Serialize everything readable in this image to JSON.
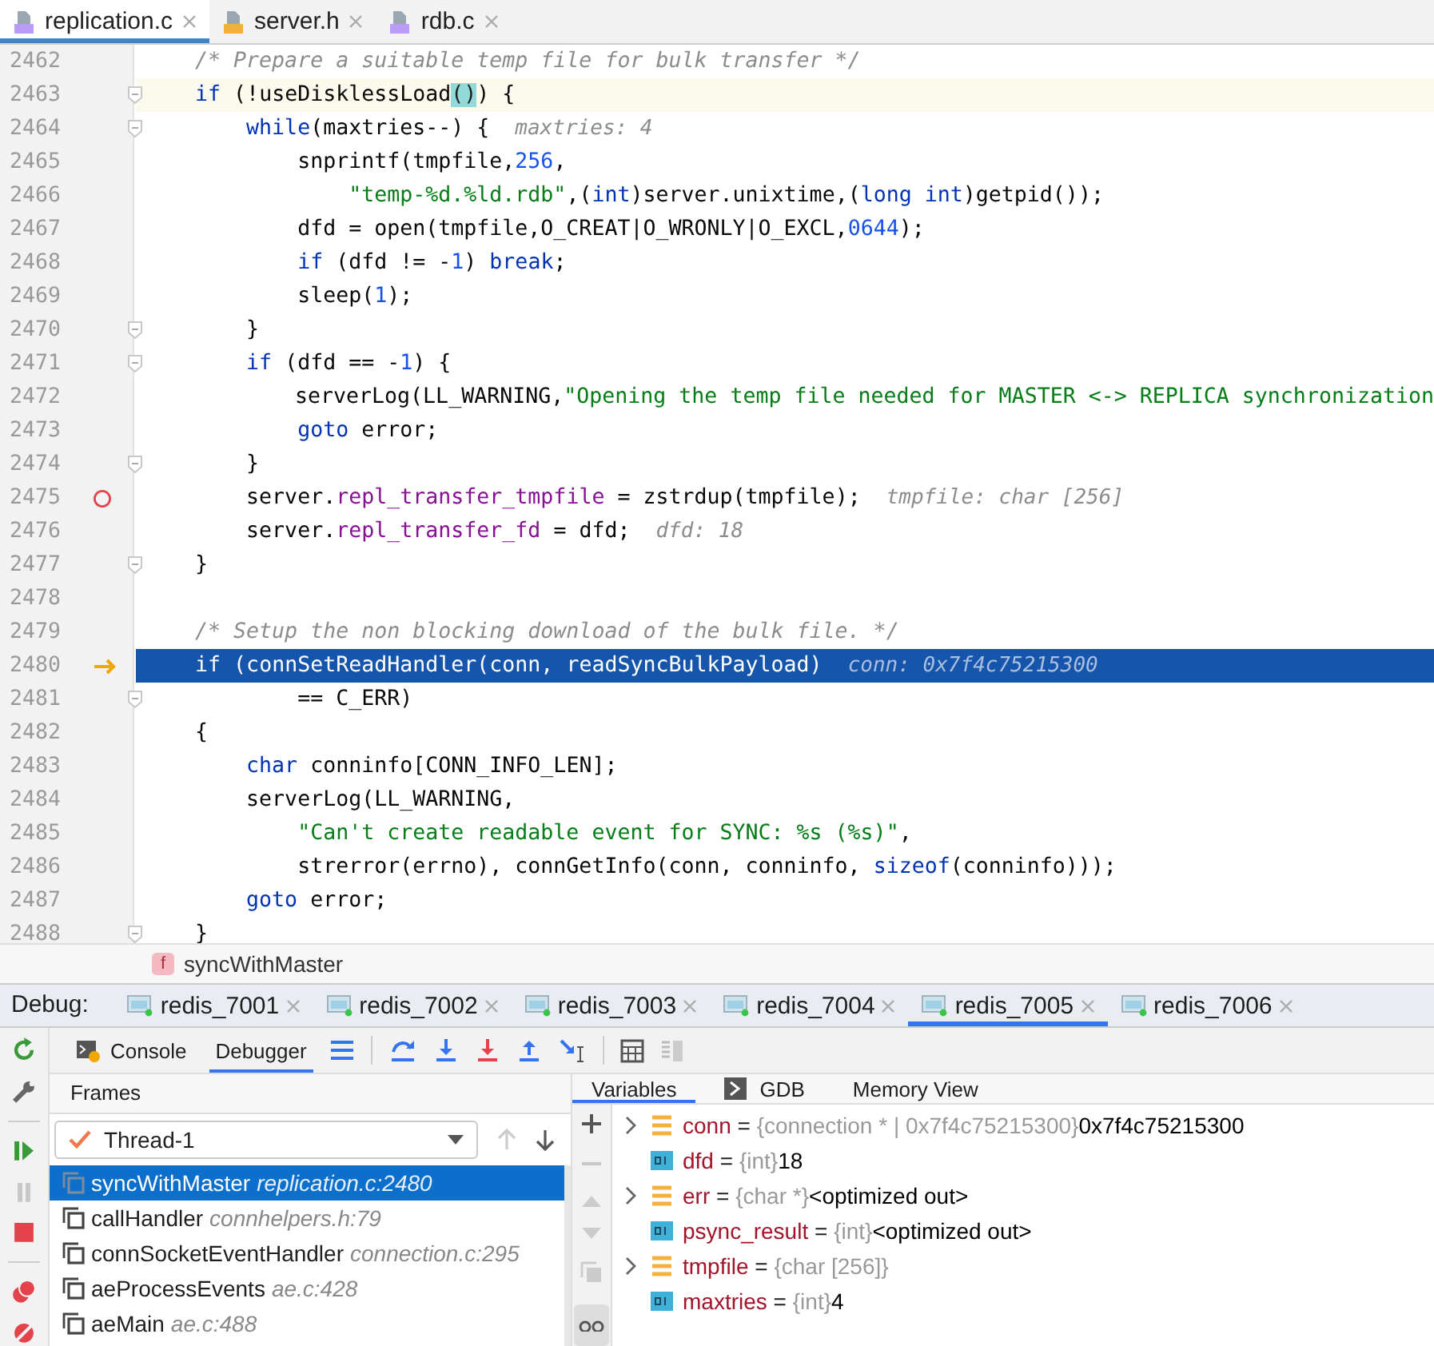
{
  "editor_tabs": [
    {
      "name": "replication.c",
      "kind": "c-source",
      "selected": true
    },
    {
      "name": "server.h",
      "kind": "header",
      "selected": false
    },
    {
      "name": "rdb.c",
      "kind": "c-source",
      "selected": false
    }
  ],
  "lines": [
    {
      "number": "2462",
      "tokens": [
        {
          "text": "    /* Prepare a suitable temp file for bulk transfer */",
          "kind": "comment"
        }
      ]
    },
    {
      "number": "2463",
      "kind": "caret-line",
      "foldable": true,
      "tokens": [
        {
          "text": "    if",
          "kind": "keyword"
        },
        {
          "text": " (!useDisklessLoad",
          "kind": "plain"
        },
        {
          "text": "()",
          "kind": "match"
        },
        {
          "text": ") {",
          "kind": "plain"
        }
      ]
    },
    {
      "number": "2464",
      "foldable": true,
      "tokens": [
        {
          "text": "        while",
          "kind": "keyword"
        },
        {
          "text": "(maxtries--) {",
          "kind": "plain"
        }
      ],
      "hint": "maxtries: 4"
    },
    {
      "number": "2465",
      "tokens": [
        {
          "text": "            snprintf(tmpfile,",
          "kind": "plain"
        },
        {
          "text": "256",
          "kind": "number"
        },
        {
          "text": ",",
          "kind": "plain"
        }
      ]
    },
    {
      "number": "2466",
      "tokens": [
        {
          "text": "                \"temp-%d.%ld.rdb\"",
          "kind": "string"
        },
        {
          "text": ",(",
          "kind": "plain"
        },
        {
          "text": "int",
          "kind": "keyword"
        },
        {
          "text": ")server.unixtime,(",
          "kind": "plain"
        },
        {
          "text": "long int",
          "kind": "keyword"
        },
        {
          "text": ")getpid());",
          "kind": "plain"
        }
      ]
    },
    {
      "number": "2467",
      "tokens": [
        {
          "text": "            dfd = open(tmpfile,O_CREAT|O_WRONLY|O_EXCL,",
          "kind": "plain"
        },
        {
          "text": "0644",
          "kind": "number"
        },
        {
          "text": ");",
          "kind": "plain"
        }
      ]
    },
    {
      "number": "2468",
      "tokens": [
        {
          "text": "            if",
          "kind": "keyword"
        },
        {
          "text": " (dfd != -",
          "kind": "plain"
        },
        {
          "text": "1",
          "kind": "number"
        },
        {
          "text": ") ",
          "kind": "plain"
        },
        {
          "text": "break",
          "kind": "keyword"
        },
        {
          "text": ";",
          "kind": "plain"
        }
      ]
    },
    {
      "number": "2469",
      "tokens": [
        {
          "text": "            sleep(",
          "kind": "plain"
        },
        {
          "text": "1",
          "kind": "number"
        },
        {
          "text": ");",
          "kind": "plain"
        }
      ]
    },
    {
      "number": "2470",
      "foldable": true,
      "tokens": [
        {
          "text": "        }",
          "kind": "plain"
        }
      ]
    },
    {
      "number": "2471",
      "foldable": true,
      "tokens": [
        {
          "text": "        if",
          "kind": "keyword"
        },
        {
          "text": " (dfd == -",
          "kind": "plain"
        },
        {
          "text": "1",
          "kind": "number"
        },
        {
          "text": ") {",
          "kind": "plain"
        }
      ]
    },
    {
      "number": "2472",
      "tokens": [
        {
          "text": "            serverLog(LL_WARNING,",
          "kind": "plain"
        },
        {
          "text": "\"Opening the temp file needed for MASTER <-> REPLICA synchronization",
          "kind": "string"
        }
      ]
    },
    {
      "number": "2473",
      "tokens": [
        {
          "text": "            goto",
          "kind": "keyword"
        },
        {
          "text": " error;",
          "kind": "plain"
        }
      ]
    },
    {
      "number": "2474",
      "foldable": true,
      "tokens": [
        {
          "text": "        }",
          "kind": "plain"
        }
      ]
    },
    {
      "number": "2475",
      "breakpoint": true,
      "tokens": [
        {
          "text": "        server.",
          "kind": "plain"
        },
        {
          "text": "repl_transfer_tmpfile",
          "kind": "field"
        },
        {
          "text": " = zstrdup(tmpfile);",
          "kind": "plain"
        }
      ],
      "hint": "tmpfile: char [256]"
    },
    {
      "number": "2476",
      "tokens": [
        {
          "text": "        server.",
          "kind": "plain"
        },
        {
          "text": "repl_transfer_fd",
          "kind": "field"
        },
        {
          "text": " = dfd;",
          "kind": "plain"
        }
      ],
      "hint": "dfd: 18"
    },
    {
      "number": "2477",
      "foldable": true,
      "tokens": [
        {
          "text": "    }",
          "kind": "plain"
        }
      ]
    },
    {
      "number": "2478"
    },
    {
      "number": "2479",
      "tokens": [
        {
          "text": "    /* Setup the non blocking download of the bulk file. */",
          "kind": "comment"
        }
      ]
    },
    {
      "number": "2480",
      "kind": "execution-line",
      "execution_point": true,
      "tokens": [
        {
          "text": "    if",
          "kind": "keyword"
        },
        {
          "text": " (connSetReadHandler(conn, readSyncBulkPayload)",
          "kind": "plain"
        }
      ],
      "hint": "conn: 0x7f4c75215300"
    },
    {
      "number": "2481",
      "foldable": true,
      "tokens": [
        {
          "text": "            == C_ERR)",
          "kind": "plain"
        }
      ]
    },
    {
      "number": "2482",
      "tokens": [
        {
          "text": "    {",
          "kind": "plain"
        }
      ]
    },
    {
      "number": "2483",
      "tokens": [
        {
          "text": "        char",
          "kind": "keyword"
        },
        {
          "text": " conninfo[CONN_INFO_LEN];",
          "kind": "plain"
        }
      ]
    },
    {
      "number": "2484",
      "tokens": [
        {
          "text": "        serverLog(LL_WARNING,",
          "kind": "plain"
        }
      ]
    },
    {
      "number": "2485",
      "tokens": [
        {
          "text": "            \"Can't create readable event for SYNC: %s (%s)\"",
          "kind": "string"
        },
        {
          "text": ",",
          "kind": "plain"
        }
      ]
    },
    {
      "number": "2486",
      "tokens": [
        {
          "text": "            strerror(errno), connGetInfo(conn, conninfo, ",
          "kind": "plain"
        },
        {
          "text": "sizeof",
          "kind": "keyword"
        },
        {
          "text": "(conninfo)));",
          "kind": "plain"
        }
      ]
    },
    {
      "number": "2487",
      "tokens": [
        {
          "text": "        goto",
          "kind": "keyword"
        },
        {
          "text": " error;",
          "kind": "plain"
        }
      ]
    },
    {
      "number": "2488",
      "foldable": true,
      "tokens": [
        {
          "text": "    }",
          "kind": "plain"
        }
      ]
    }
  ],
  "breadcrumb": {
    "icon_letter": "f",
    "label": "syncWithMaster"
  },
  "debug": {
    "label": "Debug:",
    "sessions": [
      {
        "name": "redis_7001",
        "selected": false
      },
      {
        "name": "redis_7002",
        "selected": false
      },
      {
        "name": "redis_7003",
        "selected": false
      },
      {
        "name": "redis_7004",
        "selected": false
      },
      {
        "name": "redis_7005",
        "selected": true
      },
      {
        "name": "redis_7006",
        "selected": false
      }
    ],
    "tool_tabs": [
      {
        "label": "Console",
        "selected": false
      },
      {
        "label": "Debugger",
        "selected": true
      }
    ]
  },
  "frames": {
    "title": "Frames",
    "thread": "Thread-1",
    "items": [
      {
        "name": "syncWithMaster",
        "location": "replication.c:2480",
        "selected": true
      },
      {
        "name": "callHandler",
        "location": "connhelpers.h:79",
        "selected": false
      },
      {
        "name": "connSocketEventHandler",
        "location": "connection.c:295",
        "selected": false
      },
      {
        "name": "aeProcessEvents",
        "location": "ae.c:428",
        "selected": false
      },
      {
        "name": "aeMain",
        "location": "ae.c:488",
        "selected": false
      }
    ]
  },
  "variables": {
    "tabs": [
      {
        "label": "Variables",
        "selected": true
      },
      {
        "label": "GDB",
        "selected": false
      },
      {
        "label": "Memory View",
        "selected": false
      }
    ],
    "items": [
      {
        "kind": "struct",
        "expandable": true,
        "name": "conn",
        "equals": "=",
        "type": "{connection * | 0x7f4c75215300}",
        "value": "0x7f4c75215300"
      },
      {
        "kind": "primitive",
        "expandable": false,
        "name": "dfd",
        "equals": "=",
        "type": "{int}",
        "value": "18"
      },
      {
        "kind": "struct",
        "expandable": true,
        "name": "err",
        "equals": "=",
        "type": "{char *}",
        "value": "<optimized out>"
      },
      {
        "kind": "primitive",
        "expandable": false,
        "name": "psync_result",
        "equals": "=",
        "type": "{int}",
        "value": "<optimized out>"
      },
      {
        "kind": "struct",
        "expandable": true,
        "name": "tmpfile",
        "equals": "=",
        "type": "{char [256]}"
      },
      {
        "kind": "primitive",
        "expandable": false,
        "name": "maxtries",
        "equals": "=",
        "type": "{int}",
        "value": "4"
      }
    ]
  }
}
